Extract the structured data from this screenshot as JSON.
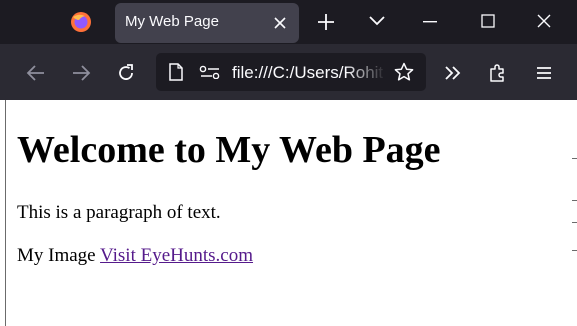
{
  "browser": {
    "tab": {
      "title": "My Web Page"
    },
    "url": "file:///C:/Users/Rohit",
    "icons": {
      "app": "firefox-icon",
      "tab_close": "close-icon",
      "new_tab": "plus-icon",
      "list_tabs": "chevron-down-icon",
      "minimize": "minimize-icon",
      "maximize": "maximize-icon",
      "close_window": "close-icon",
      "back": "back-arrow-icon",
      "forward": "forward-arrow-icon",
      "reload": "reload-icon",
      "page_info": "page-icon",
      "permissions": "permissions-icon",
      "bookmark": "star-icon",
      "overflow": "double-chevron-icon",
      "extensions": "puzzle-icon",
      "menu": "hamburger-icon"
    },
    "colors": {
      "titlebar": "#1c1b22",
      "tab": "#42414d",
      "toolbar": "#2b2a33",
      "text": "#fbfbfe"
    }
  },
  "page": {
    "heading": "Welcome to My Web Page",
    "paragraph": "This is a paragraph of text.",
    "image_alt": "My Image",
    "link_text": "Visit EyeHunts.com",
    "colors": {
      "link": "#551a8b"
    }
  }
}
